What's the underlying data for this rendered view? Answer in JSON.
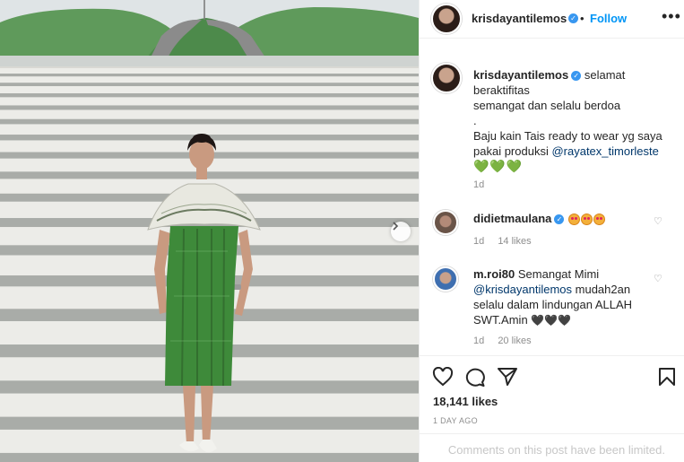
{
  "post": {
    "username": "krisdayantilemos",
    "follow_label": "Follow",
    "separator": "•",
    "more_label": "•••"
  },
  "caption": {
    "lines": [
      "selamat",
      "beraktifitas",
      "semangat dan selalu berdoa",
      ".",
      "Baju kain Tais ready to wear yg saya",
      "pakai produksi"
    ],
    "mention": "@rayatex_timorleste",
    "hearts": "💚💚💚",
    "time": "1d"
  },
  "comments": [
    {
      "username": "didietmaulana",
      "text": "",
      "emoji_count": 3,
      "time": "1d",
      "likes": "14 likes"
    },
    {
      "username": "m.roi80",
      "text_lines": [
        "Semangat Mimi",
        "mudah2an",
        "selalu dalam lindungan ALLAH",
        "SWT.Amin"
      ],
      "mention": "@krisdayantilemos",
      "hearts": "🖤🖤🖤",
      "time": "1d",
      "likes": "20 likes"
    }
  ],
  "footer": {
    "likes": "18,141 likes",
    "ago": "1 DAY AGO",
    "limited": "Comments on this post have been limited."
  },
  "icons": {
    "verified": "verified-badge-icon",
    "like": "heart-outline-icon",
    "comment": "comment-bubble-icon",
    "share": "paper-plane-icon",
    "save": "bookmark-icon",
    "next": "chevron-right-icon"
  },
  "colors": {
    "accent": "#0095f6",
    "muted": "#8e8e8e",
    "verified": "#3897f0",
    "dress_green": "#3e8a3a"
  }
}
